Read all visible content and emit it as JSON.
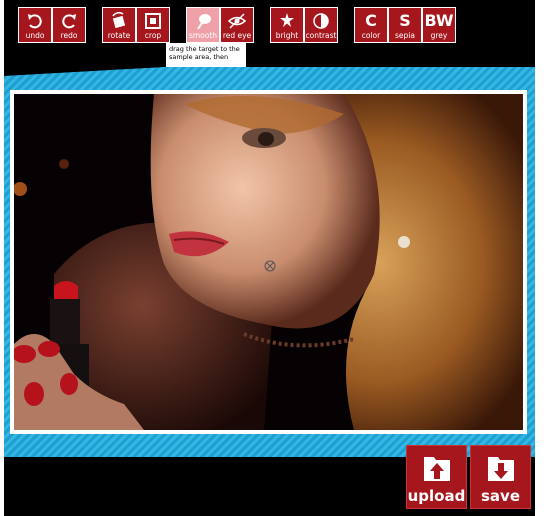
{
  "toolbar": {
    "history": [
      {
        "label": "undo",
        "icon": "undo-icon"
      },
      {
        "label": "redo",
        "icon": "redo-icon"
      }
    ],
    "transform": [
      {
        "label": "rotate",
        "icon": "rotate-icon"
      },
      {
        "label": "crop",
        "icon": "crop-icon"
      }
    ],
    "retouch": [
      {
        "label": "smooth",
        "icon": "smooth-brush-icon"
      },
      {
        "label": "red eye",
        "icon": "red-eye-icon"
      }
    ],
    "adjust": [
      {
        "label": "bright",
        "icon": "brightness-icon"
      },
      {
        "label": "contrast",
        "icon": "contrast-icon"
      }
    ],
    "filters": [
      {
        "label": "color",
        "letter": "C"
      },
      {
        "label": "sepia",
        "letter": "S"
      },
      {
        "label": "grey",
        "letter": "BW"
      }
    ]
  },
  "tooltip": {
    "text": "drag the target to the sample area, then"
  },
  "actions": {
    "upload_label": "upload",
    "save_label": "save"
  },
  "colors": {
    "accent": "#a5161d",
    "active": "#f0a0a8",
    "stripe": "#29a9dc",
    "background": "#000000"
  }
}
